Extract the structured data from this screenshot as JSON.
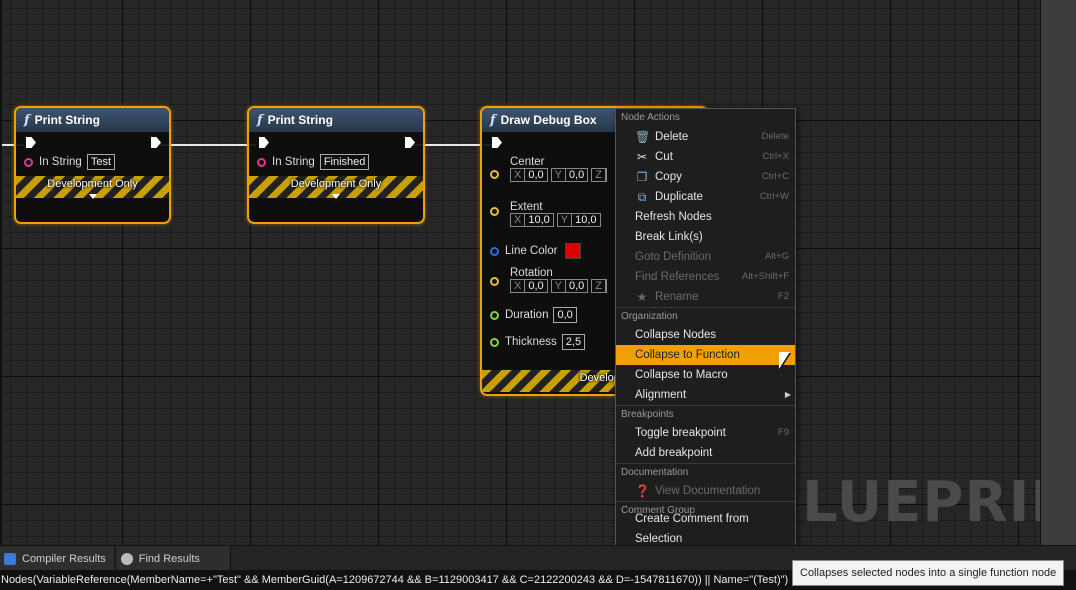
{
  "watermark": "LUEPRINT",
  "nodes": {
    "print1": {
      "title": "Print String",
      "pin_label": "In String",
      "pin_value": "Test",
      "footer": "Development Only"
    },
    "print2": {
      "title": "Print String",
      "pin_label": "In String",
      "pin_value": "Finished",
      "footer": "Development Only"
    },
    "debug_box": {
      "title": "Draw Debug Box",
      "center": {
        "label": "Center",
        "x_label": "X",
        "x": "0,0",
        "y_label": "Y",
        "y": "0,0",
        "z_label": "Z"
      },
      "extent": {
        "label": "Extent",
        "x_label": "X",
        "x": "10,0",
        "y_label": "Y",
        "y": "10,0"
      },
      "line_color": {
        "label": "Line Color",
        "color": "#e00000"
      },
      "rotation": {
        "label": "Rotation",
        "x_label": "X",
        "x": "0,0",
        "y_label": "Y",
        "y": "0,0",
        "z_label": "Z"
      },
      "duration": {
        "label": "Duration",
        "value": "0,0"
      },
      "thickness": {
        "label": "Thickness",
        "value": "2,5"
      },
      "footer": "Development O"
    }
  },
  "context_menu": {
    "sections": [
      {
        "title": "Node Actions",
        "items": [
          {
            "label": "Delete",
            "shortcut": "Delete",
            "icon": "delete-icon"
          },
          {
            "label": "Cut",
            "shortcut": "Ctrl+X",
            "icon": "cut-icon"
          },
          {
            "label": "Copy",
            "shortcut": "Ctrl+C",
            "icon": "copy-icon"
          },
          {
            "label": "Duplicate",
            "shortcut": "Ctrl+W",
            "icon": "duplicate-icon"
          },
          {
            "label": "Refresh Nodes"
          },
          {
            "label": "Break Link(s)"
          },
          {
            "label": "Goto Definition",
            "shortcut": "Alt+G",
            "disabled": true
          },
          {
            "label": "Find References",
            "shortcut": "Alt+Shift+F",
            "disabled": true
          },
          {
            "label": "Rename",
            "shortcut": "F2",
            "icon": "rename-icon",
            "disabled": true
          }
        ]
      },
      {
        "title": "Organization",
        "items": [
          {
            "label": "Collapse Nodes"
          },
          {
            "label": "Collapse to Function",
            "highlighted": true
          },
          {
            "label": "Collapse to Macro"
          },
          {
            "label": "Alignment",
            "submenu": true
          }
        ]
      },
      {
        "title": "Breakpoints",
        "items": [
          {
            "label": "Toggle breakpoint",
            "shortcut": "F9"
          },
          {
            "label": "Add breakpoint"
          }
        ]
      },
      {
        "title": "Documentation",
        "items": [
          {
            "label": "View Documentation",
            "icon": "help-icon",
            "disabled": true
          }
        ]
      },
      {
        "title": "Comment Group",
        "items": [
          {
            "label": "Create Comment from Selection"
          }
        ]
      }
    ]
  },
  "bottom_tabs": [
    {
      "label": "Compiler Results",
      "icon": "compiler-results-icon"
    },
    {
      "label": "Find Results",
      "icon": "find-results-icon"
    }
  ],
  "status_text": "Nodes(VariableReference(MemberName=+\"Test\" && MemberGuid(A=1209672744 && B=1129003417 && C=2122200243 && D=-1547811670)) || Name=\"(Test)\")",
  "tooltip": "Collapses selected nodes into a single function node"
}
